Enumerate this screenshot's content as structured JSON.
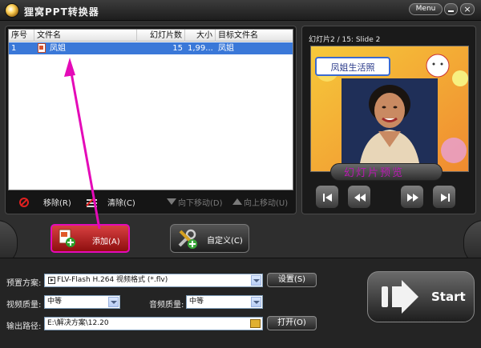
{
  "window": {
    "title": "狸窝PPT转换器",
    "menu_label": "Menu",
    "close_label": "×"
  },
  "table": {
    "columns": [
      "序号",
      "文件名",
      "幻灯片数",
      "大小",
      "目标文件名"
    ],
    "rows": [
      {
        "index": "1",
        "filename": "凤姐",
        "slides": "15",
        "size": "1,99...",
        "target": "凤姐"
      }
    ]
  },
  "list_toolbar": {
    "remove_label": "移除(R)",
    "clear_label": "清除(C)",
    "move_down_label": "向下移动(D)",
    "move_up_label": "向上移动(U)"
  },
  "preview": {
    "slide_info": "幻灯片2 / 15: Slide 2",
    "image_banner": "凤姐生活照",
    "playback_label": "幻灯片预览"
  },
  "actions": {
    "add_label": "添加(A)",
    "custom_label": "自定义(C)"
  },
  "settings": {
    "preset_label": "预置方案:",
    "preset_value": "FLV-Flash H.264 视频格式 (*.flv)",
    "settings_button": "设置(S)",
    "video_quality_label": "视频质量:",
    "video_quality_value": "中等",
    "audio_quality_label": "音频质量:",
    "audio_quality_value": "中等",
    "output_label": "输出路径:",
    "output_value": "E:\\解决方案\\12.20",
    "open_button": "打开(O)"
  },
  "start_label": "Start",
  "colors": {
    "selection": "#3a78d8",
    "annotation": "#e40ab8",
    "add_button": "#c62a2a"
  }
}
